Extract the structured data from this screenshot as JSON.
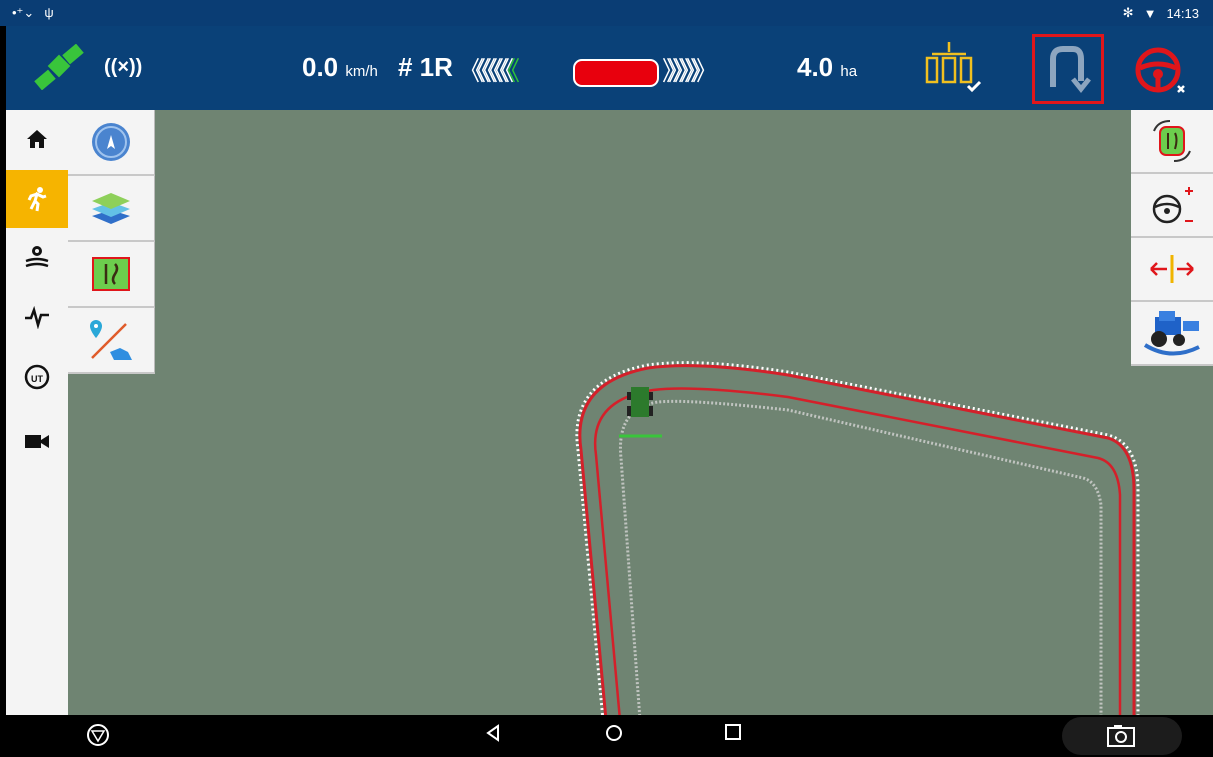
{
  "statusbar": {
    "left_icons": [
      "signal-icon",
      "usb-icon"
    ],
    "bluetooth": "✻",
    "wifi": "▼",
    "time": "14:13"
  },
  "topbar": {
    "radio_label": "((×))",
    "speed_value": "0.0",
    "speed_unit": "km/h",
    "row_label": "# 1R",
    "chevrons_left": "《《《《《《",
    "chevron_green": "《",
    "chevrons_right": "》》》》》》",
    "area_value": "4.0",
    "area_unit": "ha",
    "highlighted_button": "u-turn-button"
  },
  "leftnav": {
    "items": [
      "home-icon",
      "run-icon",
      "field-settings-icon",
      "pulse-icon",
      "ut-icon",
      "camera-icon"
    ],
    "active": "run-icon"
  },
  "tools": [
    "compass-icon",
    "layers-icon",
    "guidance-lines-icon",
    "boundary-icon"
  ],
  "right_tools": [
    "guidance-mode-icon",
    "steering-sensitivity-icon",
    "shift-line-icon",
    "tractor-view-icon"
  ],
  "colors": {
    "topbar": "#0a4178",
    "map": "#6f8472",
    "active_nav": "#f6b400",
    "highlight": "#e0161b",
    "boundary": "#e0161b"
  },
  "bottombar": {
    "items": [
      "menu-icon",
      "back-icon",
      "home-circle-icon",
      "recents-icon",
      "screenshot-icon"
    ]
  }
}
